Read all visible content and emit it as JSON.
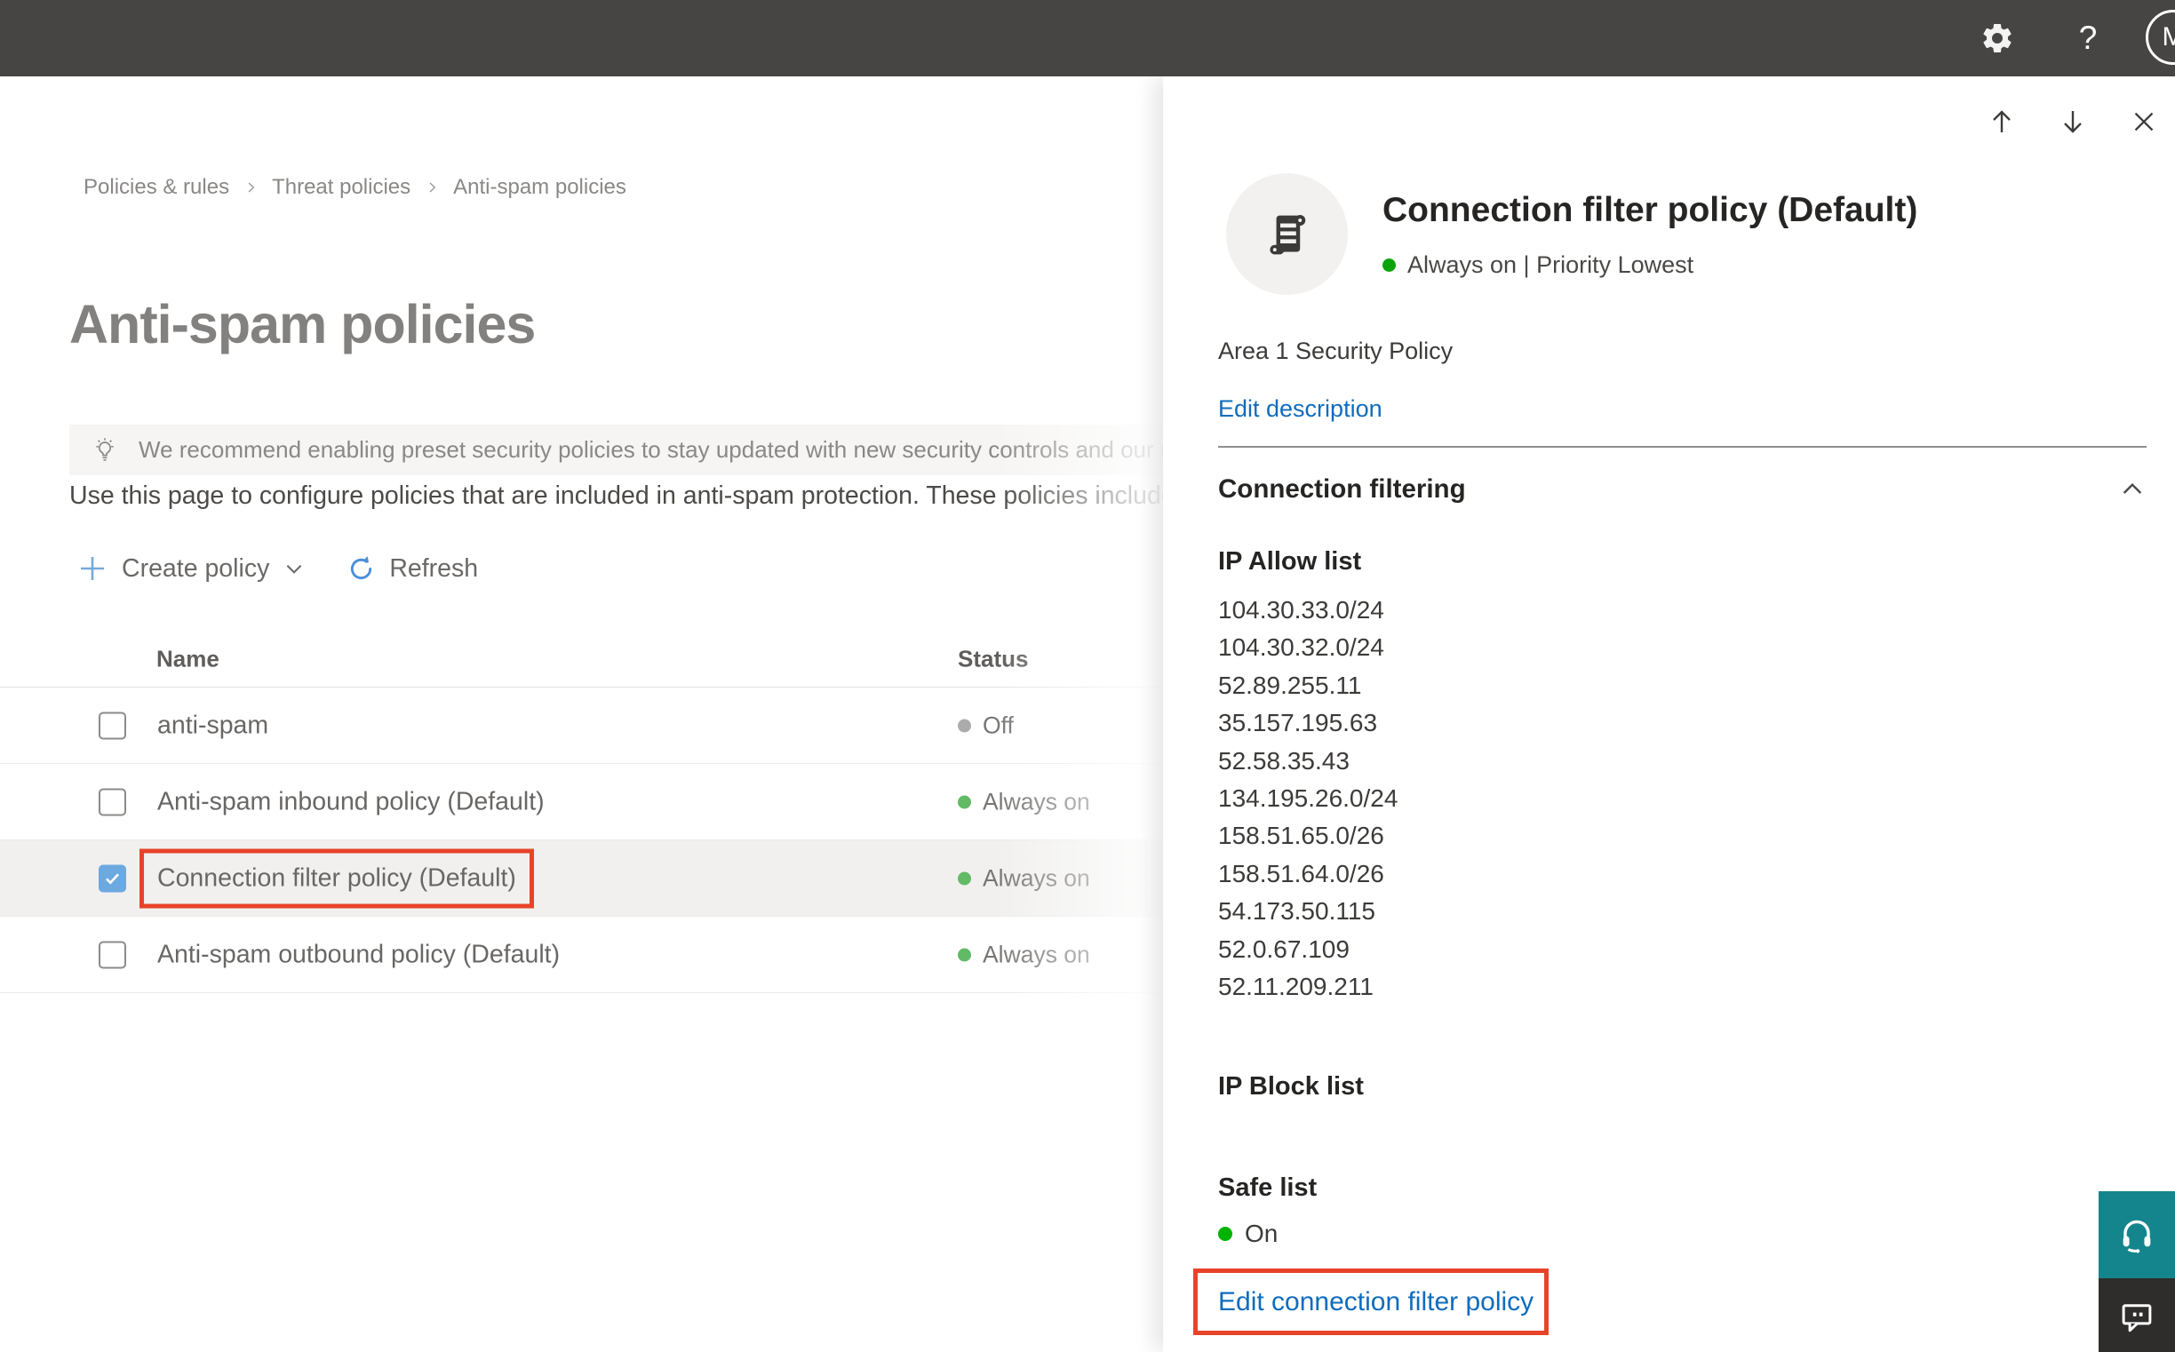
{
  "topbar": {
    "help_label": "?",
    "avatar_initial": "M"
  },
  "breadcrumb": {
    "items": [
      "Policies & rules",
      "Threat policies",
      "Anti-spam policies"
    ]
  },
  "page": {
    "title": "Anti-spam policies",
    "banner_text": "We recommend enabling preset security policies to stay updated with new security controls and our recomme",
    "description": "Use this page to configure policies that are included in anti-spam protection. These policies include"
  },
  "toolbar": {
    "create_label": "Create policy",
    "refresh_label": "Refresh"
  },
  "table": {
    "columns": {
      "name": "Name",
      "status": "Status"
    },
    "rows": [
      {
        "name": "anti-spam",
        "status": "Off",
        "dot_color": "#ababab",
        "checked": false,
        "selected": false,
        "highlighted": false
      },
      {
        "name": "Anti-spam inbound policy (Default)",
        "status": "Always on",
        "dot_color": "#62ba66",
        "checked": false,
        "selected": false,
        "highlighted": false
      },
      {
        "name": "Connection filter policy (Default)",
        "status": "Always on",
        "dot_color": "#62ba66",
        "checked": true,
        "selected": true,
        "highlighted": true
      },
      {
        "name": "Anti-spam outbound policy (Default)",
        "status": "Always on",
        "dot_color": "#62ba66",
        "checked": false,
        "selected": false,
        "highlighted": false
      }
    ]
  },
  "flyout": {
    "title": "Connection filter policy (Default)",
    "status_text": "Always on | Priority Lowest",
    "status_dot_color": "#0ba30b",
    "description": "Area 1 Security Policy",
    "edit_description_label": "Edit description",
    "section_title": "Connection filtering",
    "ip_allow": {
      "label": "IP Allow list",
      "items": [
        "104.30.33.0/24",
        "104.30.32.0/24",
        "52.89.255.11",
        "35.157.195.63",
        "52.58.35.43",
        "134.195.26.0/24",
        "158.51.65.0/26",
        "158.51.64.0/26",
        "54.173.50.115",
        "52.0.67.109",
        "52.11.209.211"
      ]
    },
    "ip_block_label": "IP Block list",
    "safe_list": {
      "label": "Safe list",
      "status": "On",
      "dot_color": "#00b300"
    },
    "edit_link_label": "Edit connection filter policy"
  },
  "colors": {
    "highlight_red": "#e8432a",
    "link_blue": "#0f6cbd",
    "checkbox_blue": "#6ca9e0",
    "status_green": "#62ba66",
    "status_gray": "#ababab",
    "teal": "#15858d"
  }
}
